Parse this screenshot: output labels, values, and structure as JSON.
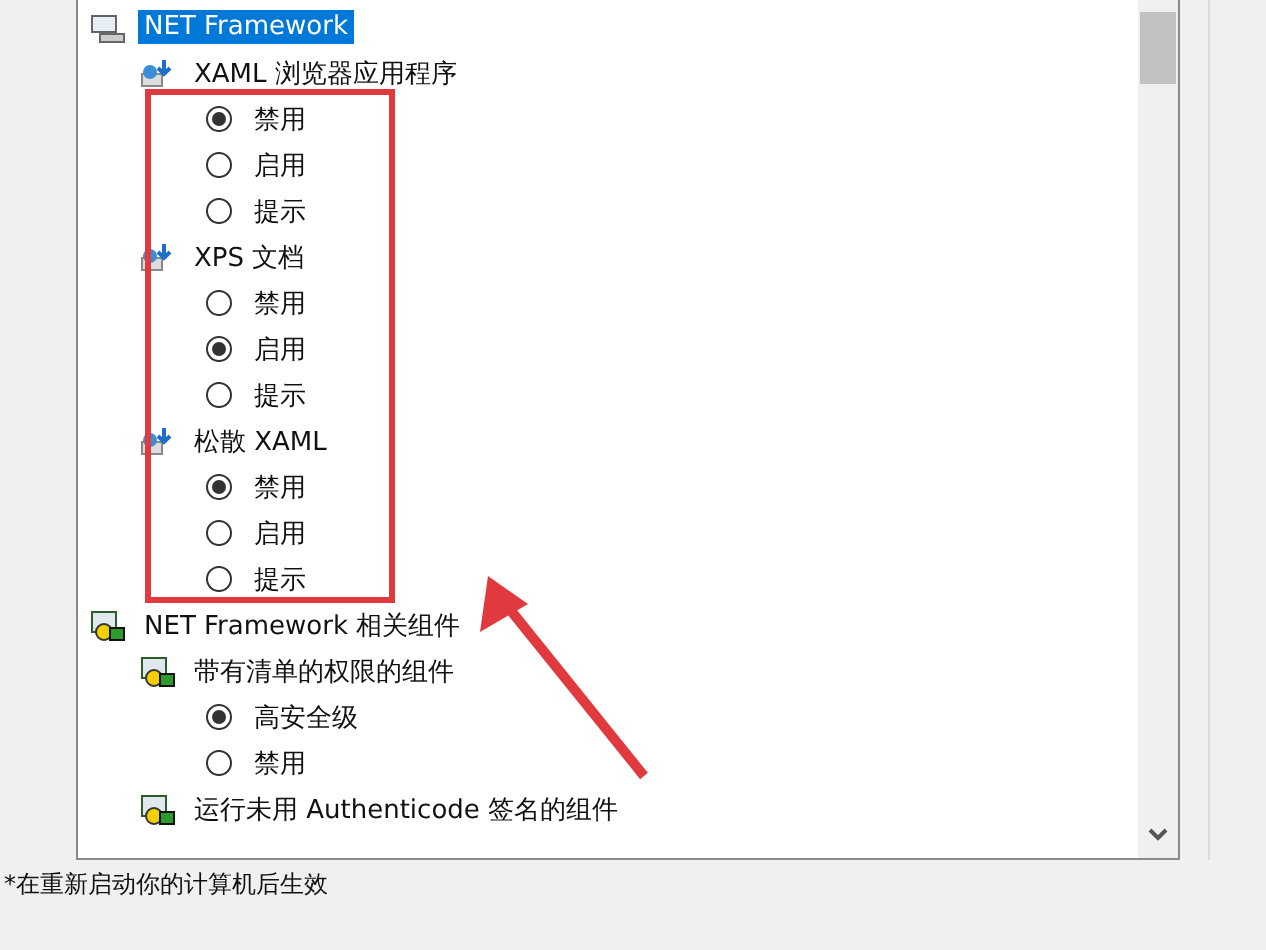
{
  "tree": {
    "items": [
      {
        "kind": "folder",
        "label": "NET Framework",
        "selected": true,
        "children": [
          {
            "kind": "setting",
            "label": "XAML 浏览器应用程序",
            "selected": false,
            "children": [
              {
                "kind": "radio",
                "label": "禁用",
                "selected": true
              },
              {
                "kind": "radio",
                "label": "启用",
                "selected": false
              },
              {
                "kind": "radio",
                "label": "提示",
                "selected": false
              }
            ]
          },
          {
            "kind": "setting",
            "label": "XPS 文档",
            "selected": false,
            "children": [
              {
                "kind": "radio",
                "label": "禁用",
                "selected": false
              },
              {
                "kind": "radio",
                "label": "启用",
                "selected": true
              },
              {
                "kind": "radio",
                "label": "提示",
                "selected": false
              }
            ]
          },
          {
            "kind": "setting",
            "label": "松散 XAML",
            "selected": false,
            "children": [
              {
                "kind": "radio",
                "label": "禁用",
                "selected": true
              },
              {
                "kind": "radio",
                "label": "启用",
                "selected": false
              },
              {
                "kind": "radio",
                "label": "提示",
                "selected": false
              }
            ]
          }
        ]
      },
      {
        "kind": "component",
        "label": "NET Framework 相关组件",
        "selected": false,
        "children": [
          {
            "kind": "component",
            "label": "带有清单的权限的组件",
            "selected": false,
            "children": [
              {
                "kind": "radio",
                "label": "高安全级",
                "selected": true
              },
              {
                "kind": "radio",
                "label": "禁用",
                "selected": false
              }
            ]
          },
          {
            "kind": "component",
            "label": "运行未用 Authenticode 签名的组件",
            "selected": false
          }
        ]
      }
    ]
  },
  "footnote": "*在重新启动你的计算机后生效"
}
